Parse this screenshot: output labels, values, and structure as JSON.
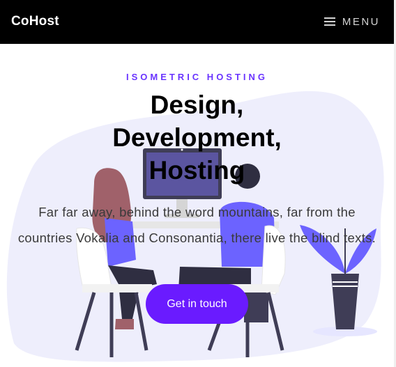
{
  "header": {
    "brand": "CoHost",
    "menu_label": "MENU"
  },
  "hero": {
    "kicker": "ISOMETRIC HOSTING",
    "headline_lines": [
      "Design,",
      "Development,",
      "Hosting"
    ],
    "lede": "Far far away, behind the word mountains, far from the countries Vokalia and Consonantia, there live the blind texts.",
    "cta_label": "Get in touch"
  },
  "colors": {
    "accent": "#6a1bff",
    "kicker": "#6a34ff",
    "blob": "#eeeefc",
    "topbar": "#000000"
  },
  "icons": [
    "hamburger-icon"
  ]
}
